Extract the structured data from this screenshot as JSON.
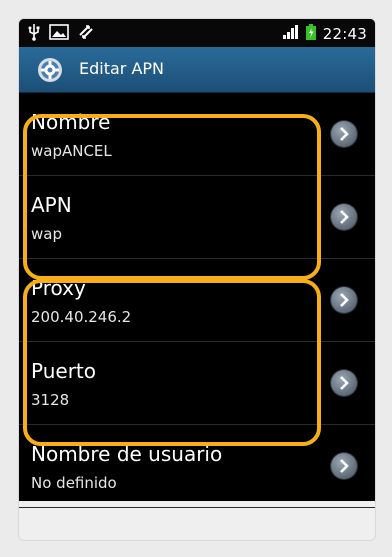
{
  "status_bar": {
    "icons_left": [
      "usb-icon",
      "image-icon",
      "sync-icon"
    ],
    "icons_right": [
      "signal-icon",
      "battery-icon"
    ],
    "time": "22:43"
  },
  "header": {
    "icon": "settings-icon",
    "title": "Editar APN"
  },
  "settings": {
    "items": [
      {
        "label": "Nombre",
        "value": "wapANCEL"
      },
      {
        "label": "APN",
        "value": "wap"
      },
      {
        "label": "Proxy",
        "value": "200.40.246.2"
      },
      {
        "label": "Puerto",
        "value": "3128"
      },
      {
        "label": "Nombre de usuario",
        "value": "No definido"
      }
    ]
  },
  "colors": {
    "highlight": "#f7ae17",
    "titlebar": "#2a6b9a",
    "background": "#000000"
  }
}
